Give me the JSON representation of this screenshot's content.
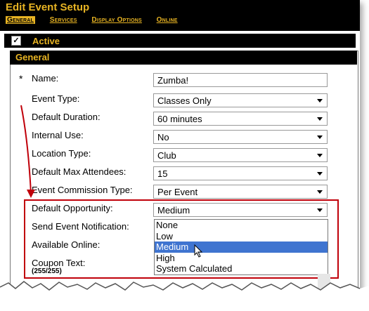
{
  "header": {
    "title": "Edit Event Setup",
    "tabs": [
      "General",
      "Services",
      "Display Options",
      "Online"
    ],
    "active_tab": "General"
  },
  "active_section": {
    "label": "Active",
    "checked_glyph": "✓"
  },
  "section": {
    "title": "General"
  },
  "form": {
    "required_mark": "*",
    "name_label": "Name:",
    "name_value": "Zumba!",
    "event_type_label": "Event Type:",
    "event_type_value": "Classes Only",
    "default_duration_label": "Default Duration:",
    "default_duration_value": "60 minutes",
    "internal_use_label": "Internal Use:",
    "internal_use_value": "No",
    "location_type_label": "Location Type:",
    "location_type_value": "Club",
    "max_attendees_label": "Default Max Attendees:",
    "max_attendees_value": "15",
    "commission_label": "Event Commission Type:",
    "commission_value": "Per Event",
    "opportunity_label": "Default Opportunity:",
    "opportunity_value": "Medium",
    "notification_label": "Send Event Notification:",
    "available_online_label": "Available Online:",
    "coupon_label": "Coupon Text:",
    "coupon_count": "(255/255)"
  },
  "opportunity_options": [
    "None",
    "Low",
    "Medium",
    "High",
    "System Calculated"
  ],
  "opportunity_selected_index": 2,
  "colors": {
    "accent": "#e8b423",
    "highlight": "#c0000a",
    "selection": "#3f74d0"
  }
}
